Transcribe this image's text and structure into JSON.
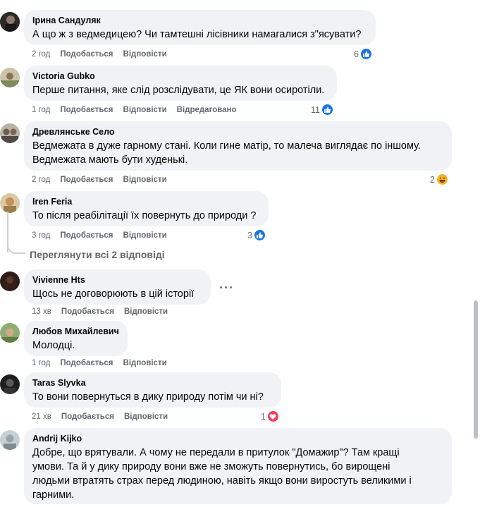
{
  "ui": {
    "like_label": "Подобається",
    "reply_label": "Відповісти",
    "edited_label": "Відредаговано",
    "view_replies": "Переглянути всі 2 відповіді",
    "more_menu": "···"
  },
  "comments": [
    {
      "author": "Ірина Сандуляк",
      "lines": [
        "А що ж з ведмедицею? Чи тамтешні лісівники намагалися з\"ясувати?"
      ],
      "time": "2 год",
      "reaction_count": "6",
      "reaction": "like-icon"
    },
    {
      "author": "Victoria Gubko",
      "lines": [
        "Перше питання, яке слід розслідувати, це ЯК вони осиротіли."
      ],
      "time": "1 год",
      "reaction_count": "11",
      "reaction": "like-icon"
    },
    {
      "author": "Древлянське Село",
      "lines": [
        "Ведмежата в дуже гарному стані. Коли гине матір, то малеча виглядає по іншому.",
        "Ведмежата мають бути худенькі."
      ],
      "time": "2 год",
      "reaction_count": "2",
      "reaction": "haha-icon"
    },
    {
      "author": "Iren Feria",
      "lines": [
        "То після реабілітації їх повернуть до природи ?"
      ],
      "time": "3 год",
      "reaction_count": "3",
      "reaction": "like-icon"
    },
    {
      "author": "Vivienne Hts",
      "lines": [
        "Щось не договорюють в цій історії"
      ],
      "time": "13 хв"
    },
    {
      "author": "Любов Михайлевич",
      "lines": [
        "Молодці."
      ],
      "time": "1 год"
    },
    {
      "author": "Taras Slyvka",
      "lines": [
        "То вони повернуться в дику природу потім чи ні?"
      ],
      "time": "21 хв",
      "reaction_count": "1",
      "reaction": "love-icon"
    },
    {
      "author": "Andrij Kijko",
      "lines": [
        "Добре, що врятували. А чому не передали в притулок \"Домажир\"? Там кращі",
        "умови. Та й у дику природу вони вже не зможуть повернутись, бо вирощені",
        "людьми втратять страх перед людиною, навіть якщо вони виростуть великими і",
        "гарними."
      ]
    }
  ],
  "colors": {
    "bubble": "#f0f2f5",
    "meta": "#65676b",
    "like": "#1b74e4",
    "love": "#f33e58",
    "haha": "#f7b125"
  }
}
